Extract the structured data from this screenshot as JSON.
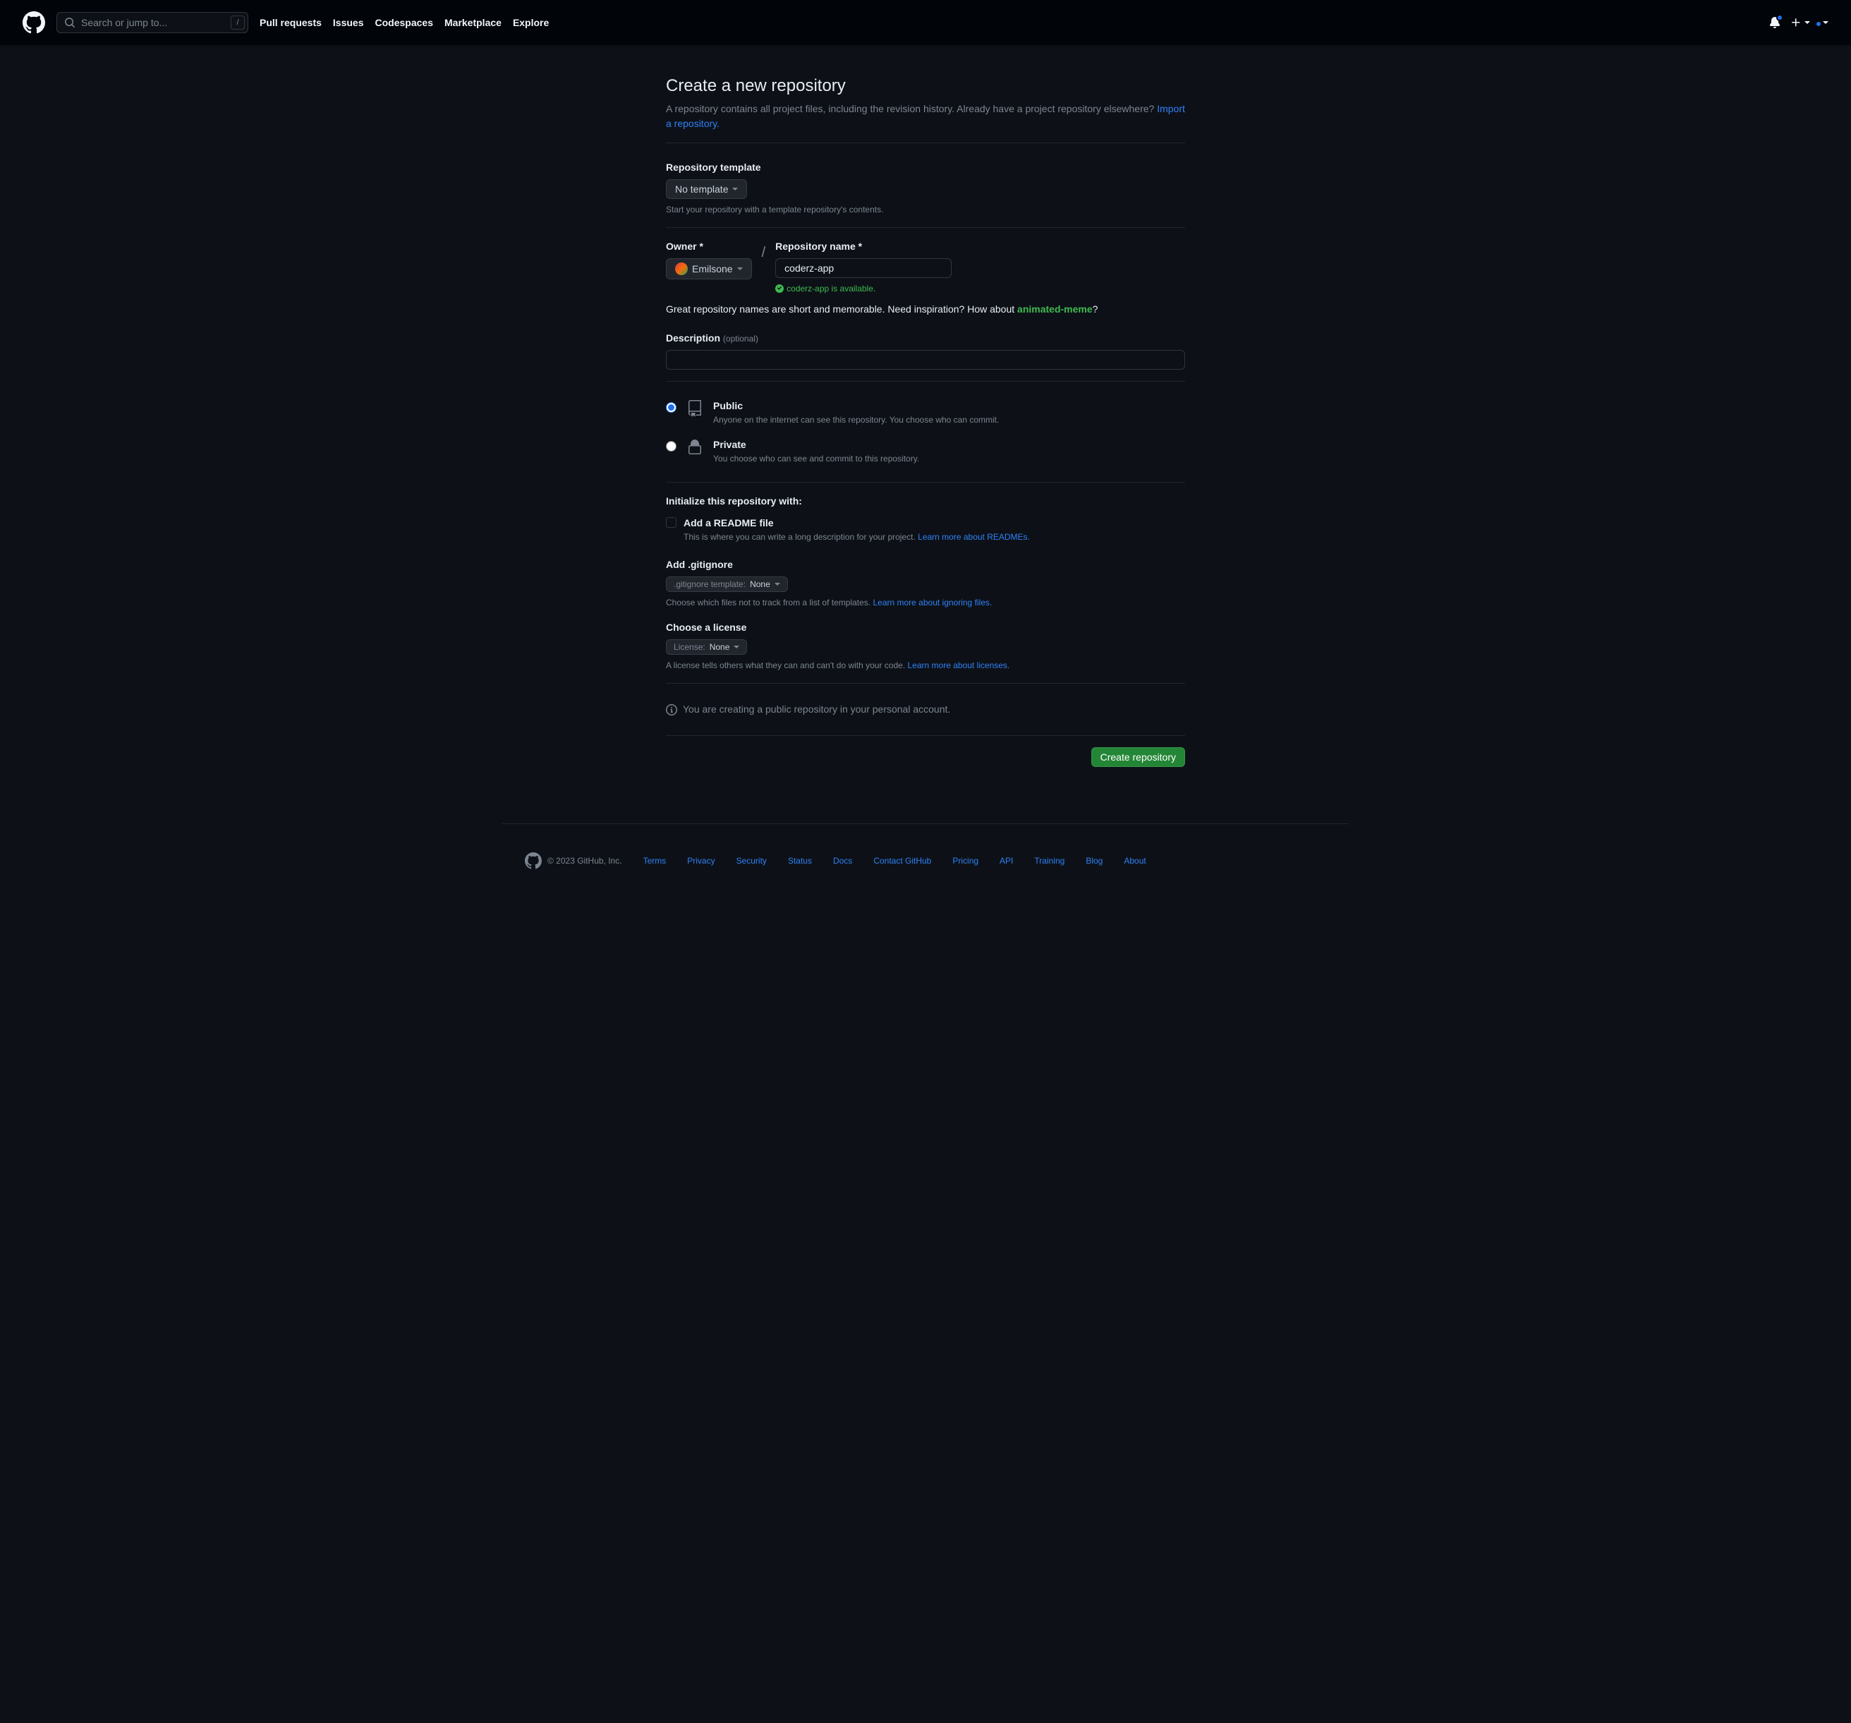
{
  "header": {
    "search_placeholder": "Search or jump to...",
    "search_key": "/",
    "nav": [
      "Pull requests",
      "Issues",
      "Codespaces",
      "Marketplace",
      "Explore"
    ]
  },
  "page": {
    "title": "Create a new repository",
    "subtitle_pre": "A repository contains all project files, including the revision history. Already have a project repository elsewhere? ",
    "import_link": "Import a repository."
  },
  "template": {
    "label": "Repository template",
    "value": "No template",
    "hint": "Start your repository with a template repository's contents."
  },
  "owner": {
    "label": "Owner *",
    "value": "Emilsone"
  },
  "repo_name": {
    "label": "Repository name *",
    "value": "coderz-app",
    "available": "coderz-app is available."
  },
  "suggest": {
    "pre": "Great repository names are short and memorable. Need inspiration? How about ",
    "name": "animated-meme",
    "post": "?"
  },
  "description": {
    "label": "Description",
    "optional": "(optional)"
  },
  "visibility": {
    "public": {
      "title": "Public",
      "desc": "Anyone on the internet can see this repository. You choose who can commit."
    },
    "private": {
      "title": "Private",
      "desc": "You choose who can see and commit to this repository."
    }
  },
  "init": {
    "heading": "Initialize this repository with:",
    "readme": {
      "title": "Add a README file",
      "desc_pre": "This is where you can write a long description for your project. ",
      "link": "Learn more about READMEs."
    }
  },
  "gitignore": {
    "label": "Add .gitignore",
    "button_prefix": ".gitignore template:",
    "button_value": "None",
    "hint_pre": "Choose which files not to track from a list of templates. ",
    "link": "Learn more about ignoring files."
  },
  "license": {
    "label": "Choose a license",
    "button_prefix": "License:",
    "button_value": "None",
    "hint_pre": "A license tells others what they can and can't do with your code. ",
    "link": "Learn more about licenses."
  },
  "info_banner": "You are creating a public repository in your personal account.",
  "submit": "Create repository",
  "footer": {
    "copyright": "© 2023 GitHub, Inc.",
    "links": [
      "Terms",
      "Privacy",
      "Security",
      "Status",
      "Docs",
      "Contact GitHub",
      "Pricing",
      "API",
      "Training",
      "Blog",
      "About"
    ]
  }
}
